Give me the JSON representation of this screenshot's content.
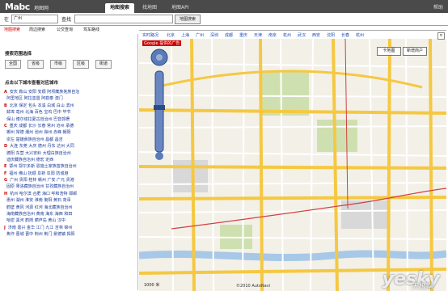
{
  "header": {
    "logo": "Mabc",
    "logo_cn": "地图网",
    "tabs": [
      "地图搜索",
      "找地图",
      "地图API"
    ],
    "right_link": "帮助"
  },
  "search": {
    "city_label": "在",
    "city_value": "广州",
    "keyword_label": "查找",
    "keyword_value": "",
    "button": "地图搜索"
  },
  "subtabs": [
    "地图搜索",
    "周边搜索",
    "公交查询",
    "驾车路线"
  ],
  "sidebar": {
    "scope_title": "搜索范围选择",
    "scope_buttons": [
      "全国",
      "省级",
      "市级",
      "区级",
      "街道"
    ],
    "city_title": "点击以下城市查看对应城市",
    "city_lines": [
      {
        "letter": "A",
        "text": "安庆 鞍山 安阳 安顺 阿坝藏族羌族自治"
      },
      {
        "letter": "",
        "text": "阿里地区 阿拉善盟 阿勒泰 澳门"
      },
      {
        "letter": "B",
        "text": "北京 保定 包头 本溪 白城 白山 滨州"
      },
      {
        "letter": "",
        "text": "蚌埠 亳州 北海 百色 宝鸡 巴中 毕节"
      },
      {
        "letter": "",
        "text": "保山 博尔塔拉蒙古自治州 巴音郭楞"
      },
      {
        "letter": "C",
        "text": "重庆 成都 长沙 长春 常州 沧州 承德"
      },
      {
        "letter": "",
        "text": "郴州 常德 潮州 池州 滁州 赤峰 朝阳"
      },
      {
        "letter": "",
        "text": "崇左 楚雄彝族自治州 昌都 昌吉"
      },
      {
        "letter": "D",
        "text": "大连 东莞 大庆 德州 丹东 达州 大同"
      },
      {
        "letter": "",
        "text": "德阳 东营 大兴安岭 大理白族自治州"
      },
      {
        "letter": "",
        "text": "迪庆藏族自治州 德宏 定西"
      },
      {
        "letter": "E",
        "text": "鄂州 鄂尔多斯 恩施土家族苗族自治州"
      },
      {
        "letter": "F",
        "text": "福州 佛山 抚顺 阜新 阜阳 防城港"
      },
      {
        "letter": "G",
        "text": "广州 贵阳 桂林 赣州 广安 广元 贵港"
      },
      {
        "letter": "",
        "text": "固原 果洛藏族自治州 甘孜藏族自治州"
      },
      {
        "letter": "H",
        "text": "杭州 哈尔滨 合肥 海口 呼和浩特 邯郸"
      },
      {
        "letter": "",
        "text": "惠州 湖州 淮安 淮南 衡阳 黄石 菏泽"
      },
      {
        "letter": "",
        "text": "鹤壁 黄冈 河源 红河 海北藏族自治州"
      },
      {
        "letter": "",
        "text": "海南藏族自治州 黄南 海东 海西 和田"
      },
      {
        "letter": "",
        "text": "哈密 黑河 鹤岗 葫芦岛 黄山 汉中"
      },
      {
        "letter": "J",
        "text": "济南 嘉兴 金华 江门 九江 吉林 锦州"
      },
      {
        "letter": "",
        "text": "焦作 晋城 晋中 荆州 荆门 景德镇 揭阳"
      }
    ]
  },
  "map": {
    "top_links": [
      "实时路况",
      "北京",
      "上海",
      "广州",
      "深圳",
      "成都",
      "重庆",
      "天津",
      "南京",
      "杭州",
      "武汉",
      "西安",
      "沈阳",
      "长春",
      "杭州"
    ],
    "overlay_button_1": "卡地图",
    "overlay_button_2": "新增商户",
    "ad_badge": "Google 提供的广告",
    "scale_text": "1000 米",
    "copyright": "©2010 AutoNavi",
    "watermark": "yesky",
    "watermark_cn": "天极网",
    "colors": {
      "road_major": "#f5c842",
      "road_minor": "#ffffff",
      "park": "#c8dca8",
      "water": "#a8c8e8",
      "rail": "#d04040"
    }
  }
}
